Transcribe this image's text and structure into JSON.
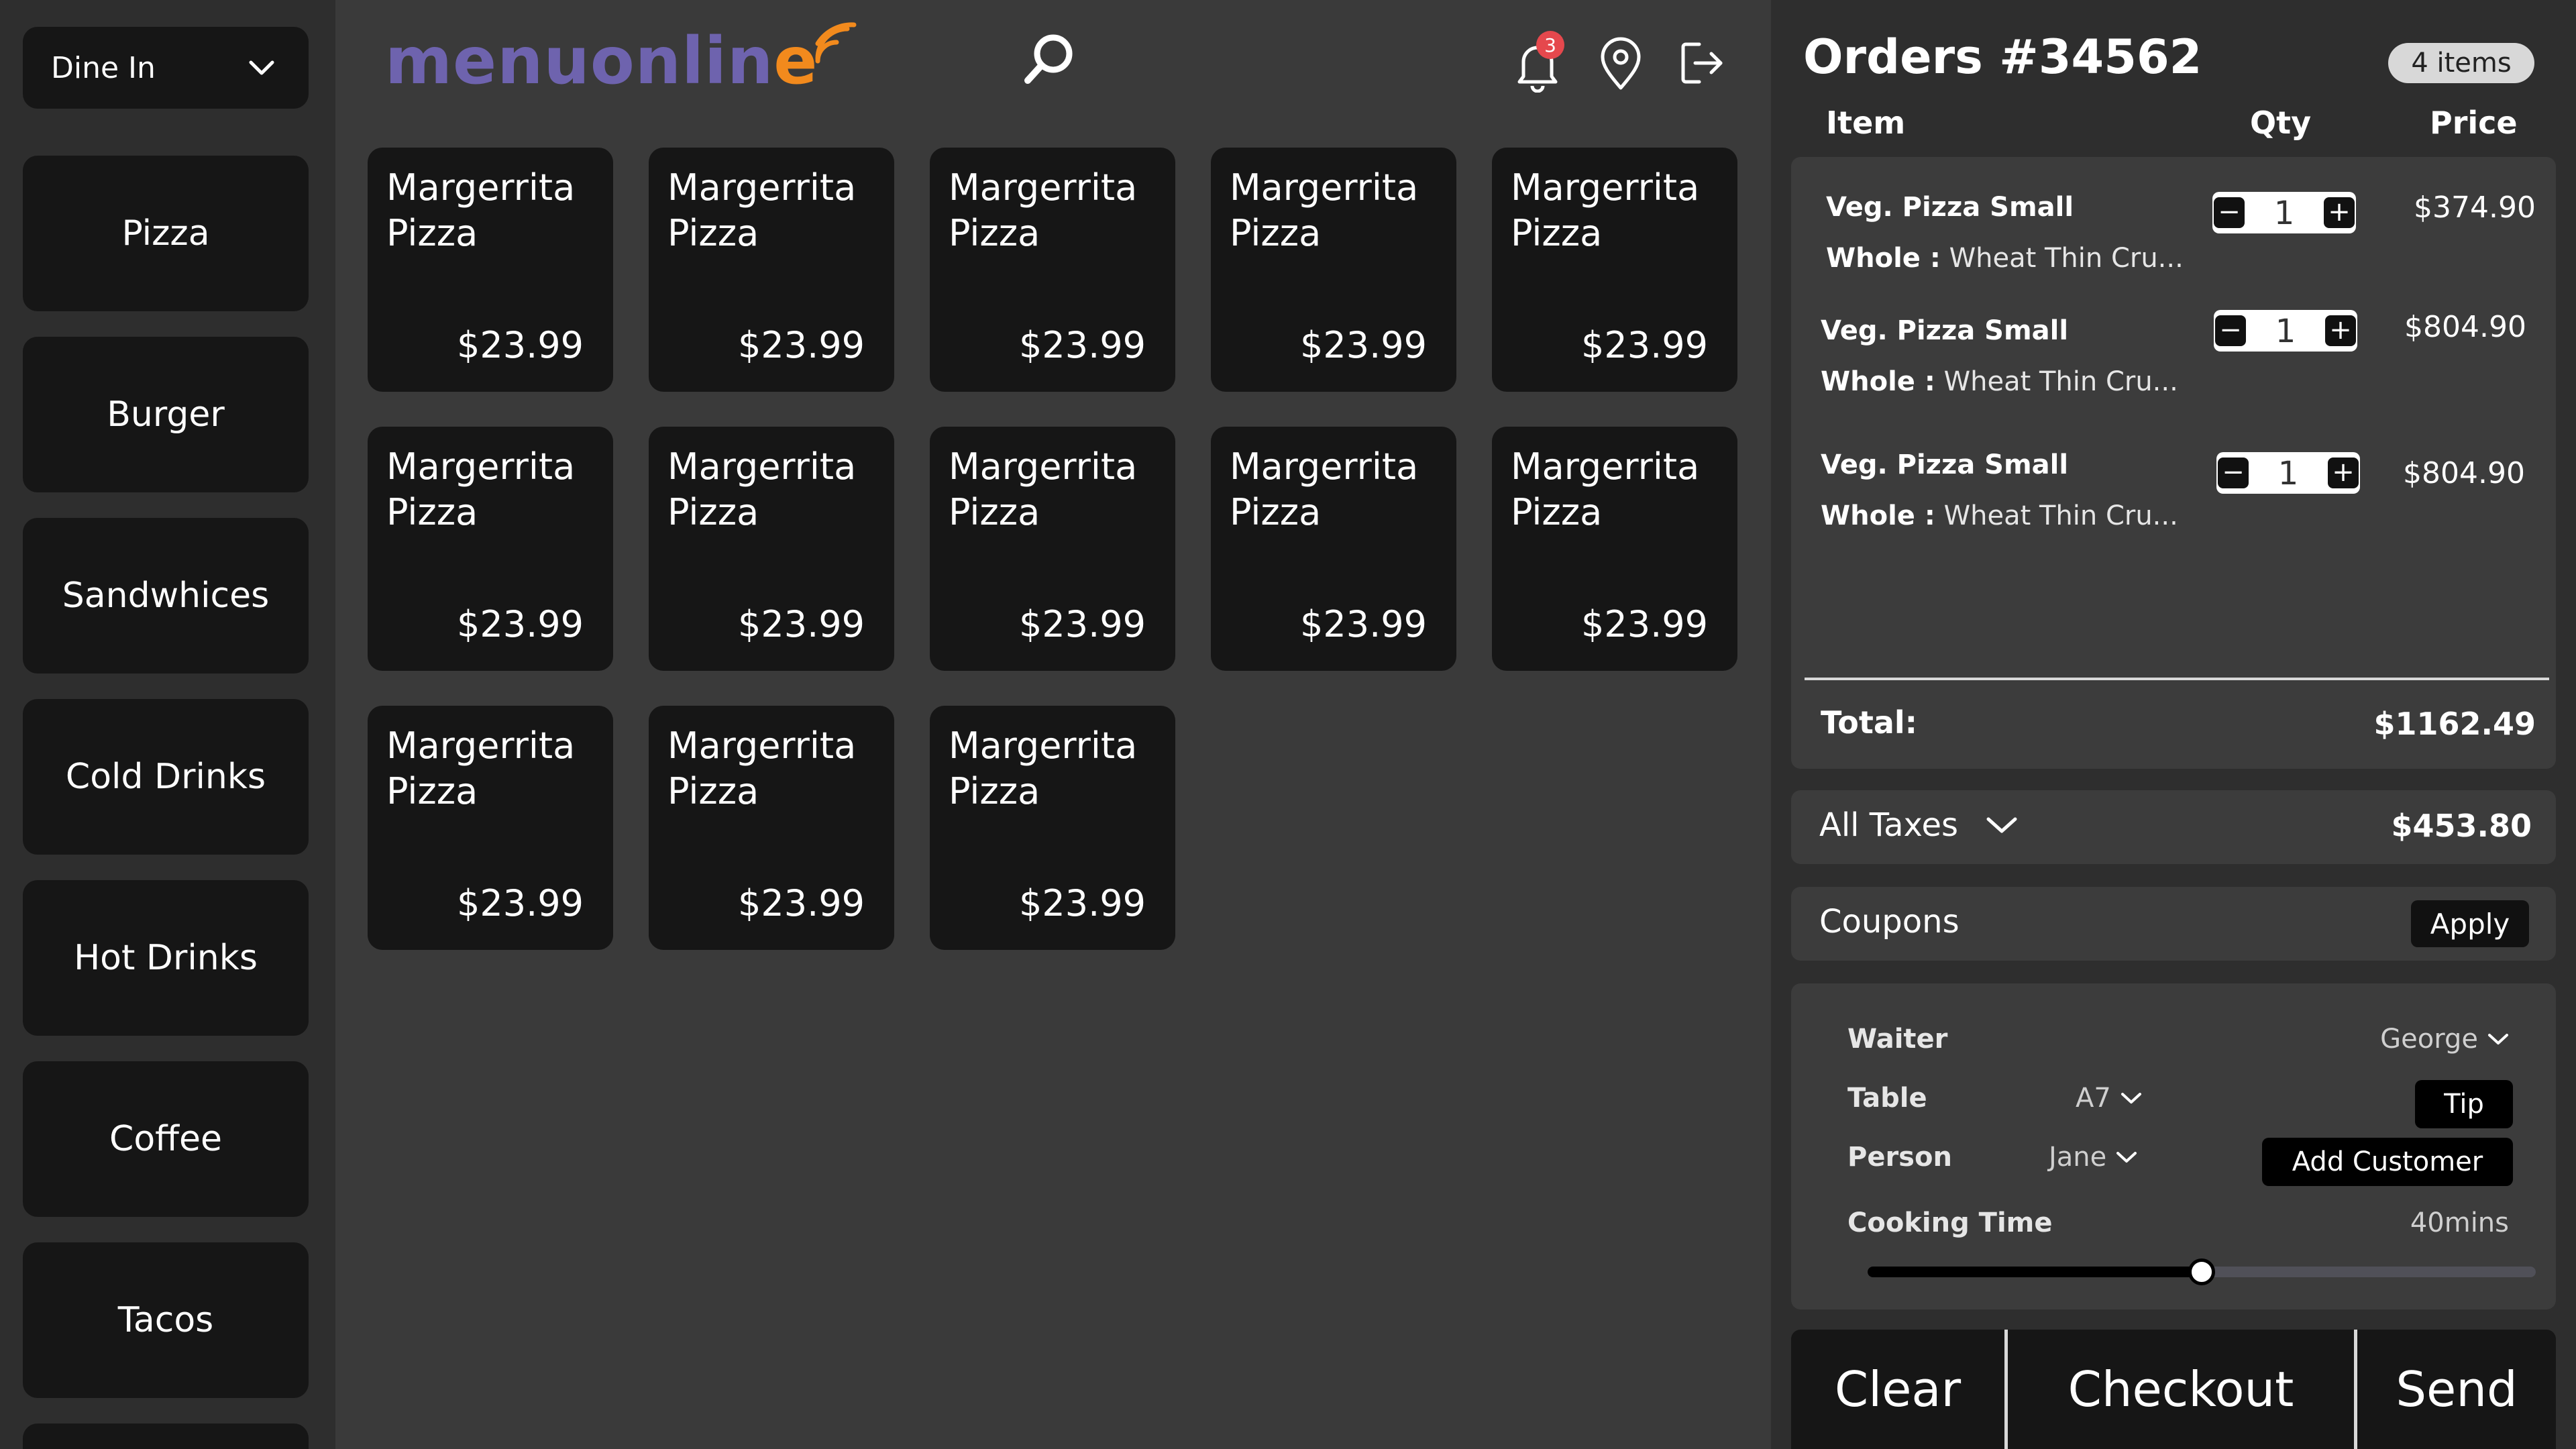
{
  "sidebar": {
    "dine_mode": "Dine In",
    "categories": [
      "Pizza",
      "Burger",
      "Sandwhices",
      "Cold Drinks",
      "Hot Drinks",
      "Coffee",
      "Tacos"
    ]
  },
  "header": {
    "logo_part1": "menuonlin",
    "logo_part2": "e",
    "notification_count": "3"
  },
  "menu": {
    "items": [
      {
        "name": "Margerrita Pizza",
        "price": "$23.99"
      },
      {
        "name": "Margerrita Pizza",
        "price": "$23.99"
      },
      {
        "name": "Margerrita Pizza",
        "price": "$23.99"
      },
      {
        "name": "Margerrita Pizza",
        "price": "$23.99"
      },
      {
        "name": "Margerrita Pizza",
        "price": "$23.99"
      },
      {
        "name": "Margerrita Pizza",
        "price": "$23.99"
      },
      {
        "name": "Margerrita Pizza",
        "price": "$23.99"
      },
      {
        "name": "Margerrita Pizza",
        "price": "$23.99"
      },
      {
        "name": "Margerrita Pizza",
        "price": "$23.99"
      },
      {
        "name": "Margerrita Pizza",
        "price": "$23.99"
      },
      {
        "name": "Margerrita Pizza",
        "price": "$23.99"
      },
      {
        "name": "Margerrita Pizza",
        "price": "$23.99"
      },
      {
        "name": "Margerrita Pizza",
        "price": "$23.99"
      }
    ]
  },
  "order": {
    "title": "Orders #34562",
    "count_label": "4 items",
    "columns": {
      "item": "Item",
      "qty": "Qty",
      "price": "Price"
    },
    "lines": [
      {
        "name": "Veg. Pizza Small",
        "sub_label": "Whole :",
        "sub_value": "Wheat Thin Cru...",
        "qty": "1",
        "price": "$374.90"
      },
      {
        "name": "Veg. Pizza Small",
        "sub_label": "Whole :",
        "sub_value": "Wheat Thin Cru...",
        "qty": "1",
        "price": "$804.90"
      },
      {
        "name": "Veg. Pizza Small",
        "sub_label": "Whole :",
        "sub_value": "Wheat Thin Cru...",
        "qty": "1",
        "price": "$804.90"
      }
    ],
    "total_label": "Total:",
    "total_value": "$1162.49",
    "taxes_label": "All Taxes",
    "taxes_value": "$453.80",
    "coupons_label": "Coupons",
    "apply_label": "Apply"
  },
  "details": {
    "waiter_label": "Waiter",
    "waiter_value": "George",
    "table_label": "Table",
    "table_value": "A7",
    "person_label": "Person",
    "person_value": "Jane",
    "tip_label": "Tip",
    "add_customer_label": "Add Customer",
    "cooking_label": "Cooking Time",
    "cooking_value": "40mins",
    "cooking_fraction": 0.5
  },
  "actions": {
    "clear": "Clear",
    "checkout": "Checkout",
    "send": "Send"
  },
  "colors": {
    "logo_purple": "#6e63ae",
    "logo_orange": "#f28a1d",
    "badge_red": "#e5484d"
  },
  "icons": [
    "chevron-down-icon",
    "search-icon",
    "bell-icon",
    "location-pin-icon",
    "logout-icon",
    "minus-icon",
    "plus-icon"
  ]
}
